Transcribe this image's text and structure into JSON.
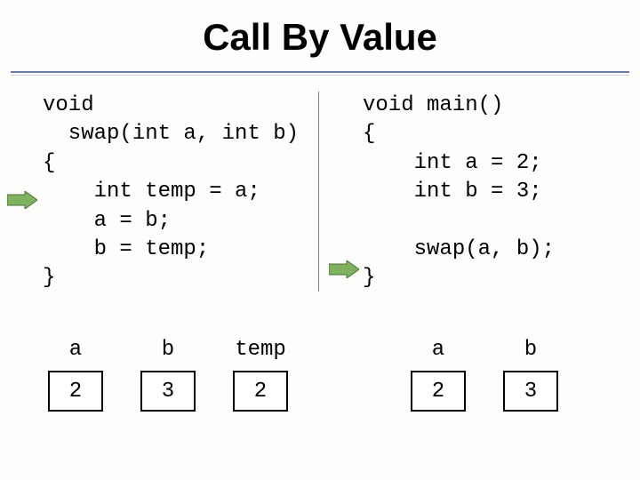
{
  "title": "Call By Value",
  "code_left": "void\n  swap(int a, int b)\n{\n    int temp = a;\n    a = b;\n    b = temp;\n}",
  "code_right": "void main()\n{\n    int a = 2;\n    int b = 3;\n\n    swap(a, b);\n}",
  "left_boxes": [
    {
      "label": "a",
      "value": "2"
    },
    {
      "label": "b",
      "value": "3"
    },
    {
      "label": "temp",
      "value": "2"
    }
  ],
  "right_boxes": [
    {
      "label": "a",
      "value": "2"
    },
    {
      "label": "b",
      "value": "3"
    }
  ]
}
